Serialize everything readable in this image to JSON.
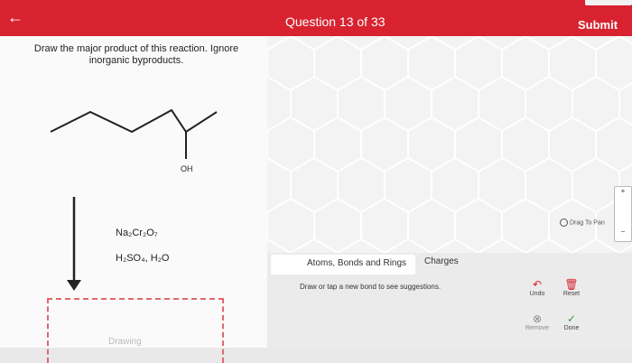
{
  "header": {
    "back_icon": "←",
    "question_label": "Question 13 of 33",
    "submit_label": "Submit"
  },
  "question": {
    "prompt": "Draw the major product of this reaction. Ignore inorganic byproducts.",
    "oh_label": "OH",
    "reagent1": "Na₂Cr₂O₇",
    "reagent2": "H₂SO₄, H₂O"
  },
  "answer": {
    "drawing_label": "Drawing"
  },
  "editor": {
    "tabs": [
      "Atoms, Bonds and Rings",
      "Charges"
    ],
    "hint": "Draw or tap a new bond to see suggestions.",
    "drag_label": "Drag To Pan",
    "tools": [
      "Undo",
      "Reset",
      "Remove",
      "Done"
    ]
  },
  "colors": {
    "brand": "#d8222f"
  }
}
